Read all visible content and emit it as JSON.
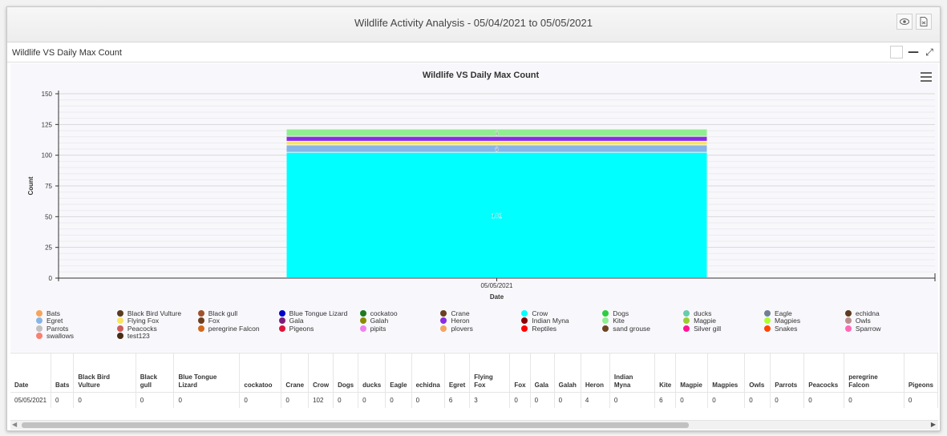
{
  "window": {
    "title": "Wildlife Activity Analysis - 05/04/2021 to 05/05/2021",
    "view_icon": "eye-icon",
    "export_icon": "document-icon"
  },
  "panel": {
    "title": "Wildlife VS Daily Max Count"
  },
  "chart_data": {
    "type": "bar",
    "stacked": true,
    "title": "Wildlife VS Daily Max Count",
    "xlabel": "Date",
    "ylabel": "Count",
    "categories": [
      "05/05/2021"
    ],
    "ylim": [
      0,
      150
    ],
    "yticks": [
      0,
      25,
      50,
      75,
      100,
      125,
      150
    ],
    "legend_position": "bottom",
    "series": [
      {
        "name": "Bats",
        "color": "#f7a35c",
        "values": [
          0
        ]
      },
      {
        "name": "Black Bird Vulture",
        "color": "#5c3b1e",
        "values": [
          0
        ]
      },
      {
        "name": "Black gull",
        "color": "#a0522d",
        "values": [
          0
        ]
      },
      {
        "name": "Blue Tongue Lizard",
        "color": "#0000cd",
        "values": [
          0
        ]
      },
      {
        "name": "cockatoo",
        "color": "#1e7a1e",
        "values": [
          0
        ]
      },
      {
        "name": "Crane",
        "color": "#6b3f1f",
        "values": [
          0
        ]
      },
      {
        "name": "Crow",
        "color": "#00ffff",
        "values": [
          102
        ]
      },
      {
        "name": "Dogs",
        "color": "#2ecc40",
        "values": [
          0
        ]
      },
      {
        "name": "ducks",
        "color": "#66cdaa",
        "values": [
          0
        ]
      },
      {
        "name": "Eagle",
        "color": "#708090",
        "values": [
          0
        ]
      },
      {
        "name": "echidna",
        "color": "#5c3b1e",
        "values": [
          0
        ]
      },
      {
        "name": "Egret",
        "color": "#87b5e8",
        "values": [
          6
        ]
      },
      {
        "name": "Flying Fox",
        "color": "#f7e463",
        "values": [
          3
        ]
      },
      {
        "name": "Fox",
        "color": "#6b3f1f",
        "values": [
          0
        ]
      },
      {
        "name": "Gala",
        "color": "#7b1c7b",
        "values": [
          0
        ]
      },
      {
        "name": "Galah",
        "color": "#8b8b00",
        "values": [
          0
        ]
      },
      {
        "name": "Heron",
        "color": "#8a2be2",
        "values": [
          4
        ]
      },
      {
        "name": "Indian Myna",
        "color": "#8b0000",
        "values": [
          0
        ]
      },
      {
        "name": "Kite",
        "color": "#90ee90",
        "values": [
          6
        ]
      },
      {
        "name": "Magpie",
        "color": "#9acd32",
        "values": [
          0
        ]
      },
      {
        "name": "Magpies",
        "color": "#adff2f",
        "values": [
          0
        ]
      },
      {
        "name": "Owls",
        "color": "#bc8f8f",
        "values": [
          0
        ]
      },
      {
        "name": "Parrots",
        "color": "#c0c0c0",
        "values": [
          0
        ]
      },
      {
        "name": "Peacocks",
        "color": "#cd5c5c",
        "values": [
          0
        ]
      },
      {
        "name": "peregrine Falcon",
        "color": "#d2691e",
        "values": [
          0
        ]
      },
      {
        "name": "Pigeons",
        "color": "#dc143c",
        "values": [
          0
        ]
      },
      {
        "name": "pipits",
        "color": "#ee82ee",
        "values": [
          0
        ]
      },
      {
        "name": "plovers",
        "color": "#f4a460",
        "values": [
          0
        ]
      },
      {
        "name": "Reptiles",
        "color": "#ff0000",
        "values": [
          0
        ]
      },
      {
        "name": "sand grouse",
        "color": "#6b4423",
        "values": [
          0
        ]
      },
      {
        "name": "Silver gill",
        "color": "#ff1493",
        "values": [
          0
        ]
      },
      {
        "name": "Snakes",
        "color": "#ff4500",
        "values": [
          0
        ]
      },
      {
        "name": "Sparrow",
        "color": "#ff69b4",
        "values": [
          0
        ]
      },
      {
        "name": "swallows",
        "color": "#fa8072",
        "values": [
          0
        ]
      },
      {
        "name": "test123",
        "color": "#4a2c14",
        "values": [
          0
        ]
      }
    ],
    "data_labels": [
      {
        "series": "Crow",
        "text": "102"
      },
      {
        "series": "Egret",
        "text": "6"
      },
      {
        "series": "Kite",
        "text": "6"
      }
    ]
  },
  "table": {
    "headers": [
      "Date",
      "Bats",
      "Black Bird Vulture",
      "Black gull",
      "Blue Tongue Lizard",
      "cockatoo",
      "Crane",
      "Crow",
      "Dogs",
      "ducks",
      "Eagle",
      "echidna",
      "Egret",
      "Flying Fox",
      "Fox",
      "Gala",
      "Galah",
      "Heron",
      "Indian Myna",
      "Kite",
      "Magpie",
      "Magpies",
      "Owls",
      "Parrots",
      "Peacocks",
      "peregrine Falcon",
      "Pigeons"
    ],
    "rows": [
      [
        "05/05/2021",
        "0",
        "0",
        "0",
        "0",
        "0",
        "0",
        "102",
        "0",
        "0",
        "0",
        "0",
        "6",
        "3",
        "0",
        "0",
        "0",
        "4",
        "0",
        "6",
        "0",
        "0",
        "0",
        "0",
        "0",
        "0",
        "0"
      ]
    ]
  }
}
